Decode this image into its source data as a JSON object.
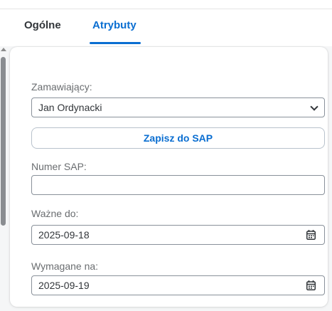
{
  "tabs": [
    {
      "label": "Ogólne",
      "active": false
    },
    {
      "label": "Atrybuty",
      "active": true
    }
  ],
  "form": {
    "orderer": {
      "label": "Zamawiający:",
      "value": "Jan Ordynacki"
    },
    "save_button": "Zapisz do SAP",
    "sap_number": {
      "label": "Numer SAP:",
      "value": ""
    },
    "valid_until": {
      "label": "Ważne do:",
      "value": "2025-09-18"
    },
    "required_on": {
      "label": "Wymagane na:",
      "value": "2025-09-19"
    }
  },
  "icons": {
    "select": "chevron-down-icon",
    "date": "calendar-icon"
  },
  "colors": {
    "accent": "#0a6ed1",
    "text": "#32363a",
    "label": "#6a6d70",
    "border": "#89919a"
  }
}
